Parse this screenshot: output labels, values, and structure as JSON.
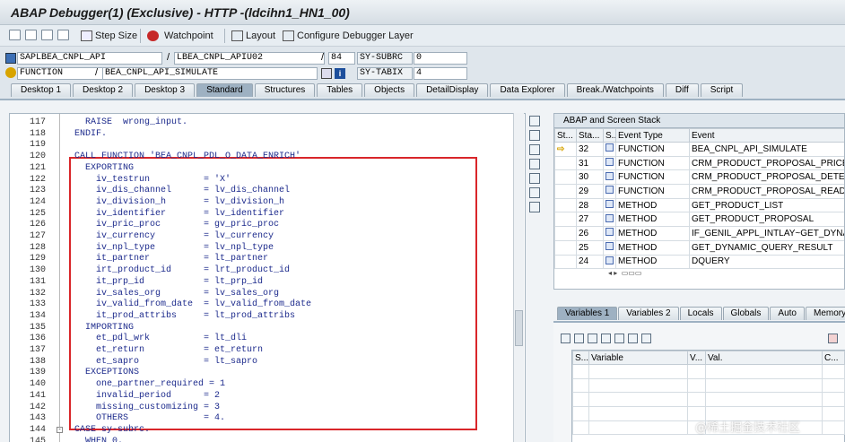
{
  "window": {
    "title": "ABAP Debugger(1)  (Exclusive) - HTTP -(ldcihn1_HN1_00)"
  },
  "toolbar": {
    "step_size": "Step Size",
    "watchpoint": "Watchpoint",
    "layout": "Layout",
    "configure": "Configure Debugger Layer"
  },
  "program": {
    "program": "SAPLBEA_CNPL_API",
    "include": "LBEA_CNPL_APIU02",
    "line": "84",
    "subrc_label": "SY-SUBRC",
    "subrc_value": "0",
    "event_type": "FUNCTION",
    "event": "BEA_CNPL_API_SIMULATE",
    "tabix_label": "SY-TABIX",
    "tabix_value": "4"
  },
  "tabs": [
    "Desktop 1",
    "Desktop 2",
    "Desktop 3",
    "Standard",
    "Structures",
    "Tables",
    "Objects",
    "DetailDisplay",
    "Data Explorer",
    "Break./Watchpoints",
    "Diff",
    "Script"
  ],
  "source_lines": [
    {
      "n": "117",
      "t": "  RAISE  wrong_input."
    },
    {
      "n": "118",
      "t": "ENDIF."
    },
    {
      "n": "119",
      "t": ""
    },
    {
      "n": "120",
      "t": "CALL FUNCTION 'BEA_CNPL_PDL_O_DATA_ENRICH'"
    },
    {
      "n": "121",
      "t": "  EXPORTING"
    },
    {
      "n": "122",
      "t": "    iv_testrun          = 'X'"
    },
    {
      "n": "123",
      "t": "    iv_dis_channel      = lv_dis_channel"
    },
    {
      "n": "124",
      "t": "    iv_division_h       = lv_division_h"
    },
    {
      "n": "125",
      "t": "    iv_identifier       = lv_identifier"
    },
    {
      "n": "126",
      "t": "    iv_pric_proc        = gv_pric_proc"
    },
    {
      "n": "127",
      "t": "    iv_currency         = lv_currency"
    },
    {
      "n": "128",
      "t": "    iv_npl_type         = lv_npl_type"
    },
    {
      "n": "129",
      "t": "    it_partner          = lt_partner"
    },
    {
      "n": "130",
      "t": "    irt_product_id      = lrt_product_id"
    },
    {
      "n": "131",
      "t": "    it_prp_id           = lt_prp_id"
    },
    {
      "n": "132",
      "t": "    iv_sales_org        = lv_sales_org"
    },
    {
      "n": "133",
      "t": "    iv_valid_from_date  = lv_valid_from_date"
    },
    {
      "n": "134",
      "t": "    it_prod_attribs     = lt_prod_attribs"
    },
    {
      "n": "135",
      "t": "  IMPORTING"
    },
    {
      "n": "136",
      "t": "    et_pdl_wrk          = lt_dli"
    },
    {
      "n": "137",
      "t": "    et_return           = et_return"
    },
    {
      "n": "138",
      "t": "    et_sapro            = lt_sapro"
    },
    {
      "n": "139",
      "t": "  EXCEPTIONS"
    },
    {
      "n": "140",
      "t": "    one_partner_required = 1"
    },
    {
      "n": "141",
      "t": "    invalid_period      = 2"
    },
    {
      "n": "142",
      "t": "    missing_customizing = 3"
    },
    {
      "n": "143",
      "t": "    OTHERS              = 4."
    },
    {
      "n": "144",
      "t": "CASE sy-subrc."
    },
    {
      "n": "145",
      "t": "  WHEN 0."
    }
  ],
  "stack": {
    "title": "ABAP and Screen Stack",
    "headers": [
      "St...",
      "Sta...",
      "S...",
      "Event Type",
      "Event"
    ],
    "rows": [
      {
        "level": "32",
        "type": "FUNCTION",
        "event": "BEA_CNPL_API_SIMULATE",
        "current": true
      },
      {
        "level": "31",
        "type": "FUNCTION",
        "event": "CRM_PRODUCT_PROPOSAL_PRICEDET"
      },
      {
        "level": "30",
        "type": "FUNCTION",
        "event": "CRM_PRODUCT_PROPOSAL_DETERMINE"
      },
      {
        "level": "29",
        "type": "FUNCTION",
        "event": "CRM_PRODUCT_PROPOSAL_READ"
      },
      {
        "level": "28",
        "type": "METHOD",
        "event": "GET_PRODUCT_LIST"
      },
      {
        "level": "27",
        "type": "METHOD",
        "event": "GET_PRODUCT_PROPOSAL"
      },
      {
        "level": "26",
        "type": "METHOD",
        "event": "IF_GENIL_APPL_INTLAY~GET_DYNAMIC_"
      },
      {
        "level": "25",
        "type": "METHOD",
        "event": "GET_DYNAMIC_QUERY_RESULT"
      },
      {
        "level": "24",
        "type": "METHOD",
        "event": "DQUERY"
      }
    ]
  },
  "var_tabs": [
    "Variables 1",
    "Variables 2",
    "Locals",
    "Globals",
    "Auto",
    "Memory"
  ],
  "var_grid": {
    "headers": [
      "S...",
      "Variable",
      "V...",
      "Val.",
      "C..."
    ]
  },
  "watermark": "@稀土掘金技术社区",
  "colors": {
    "highlight_box": "#d9262a",
    "active_tab": "#9eb1c2",
    "keyword": "#1c2a8c",
    "string": "#2e8b2e"
  }
}
